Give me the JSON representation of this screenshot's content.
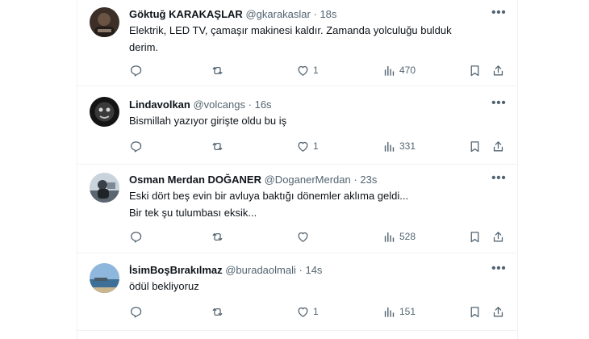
{
  "tweets": [
    {
      "name": "Göktuğ KARAKAŞLAR",
      "handle": "@gkarakaslar",
      "separator": "·",
      "time": "18s",
      "text": "Elektrik, LED TV, çamaşır makinesi kaldır. Zamanda yolculuğu bulduk\nderim.",
      "likes": "1",
      "views": "470"
    },
    {
      "name": "Lindavolkan",
      "handle": "@volcangs",
      "separator": "·",
      "time": "16s",
      "text": "Bismillah yazıyor girişte oldu bu iş",
      "likes": "1",
      "views": "331"
    },
    {
      "name": "Osman Merdan DOĞANER",
      "handle": "@DoganerMerdan",
      "separator": "·",
      "time": "23s",
      "text": "Eski dört beş evin bir avluya baktığı  dönemler aklıma geldi...\nBir tek şu tulumbası eksik...",
      "likes": "",
      "views": "528"
    },
    {
      "name": "İsimBoşBırakılmaz",
      "handle": "@buradaolmali",
      "separator": "·",
      "time": "14s",
      "text": "ödül bekliyoruz",
      "likes": "1",
      "views": "151"
    }
  ],
  "icons": {
    "more": "more-icon",
    "reply": "reply-icon",
    "retweet": "retweet-icon",
    "like": "heart-icon",
    "views": "views-icon",
    "bookmark": "bookmark-icon",
    "share": "share-icon"
  },
  "colors": {
    "name": "#0f1419",
    "meta": "#536471",
    "divider": "#eff3f4"
  }
}
